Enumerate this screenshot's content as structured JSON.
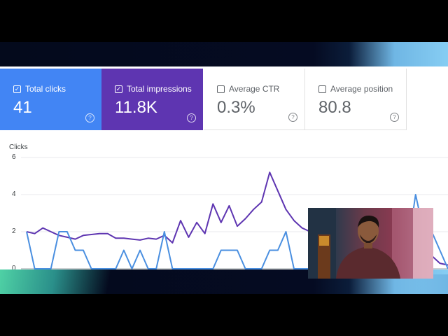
{
  "metrics": [
    {
      "label": "Total clicks",
      "value": "41",
      "active": true,
      "color": "#4285f4"
    },
    {
      "label": "Total impressions",
      "value": "11.8K",
      "active": true,
      "color": "#5e35b1"
    },
    {
      "label": "Average CTR",
      "value": "0.3%",
      "active": false
    },
    {
      "label": "Average position",
      "value": "80.8",
      "active": false
    }
  ],
  "chart": {
    "axis_title": "Clicks",
    "y_ticks": [
      "6",
      "4",
      "2",
      "0"
    ]
  },
  "chart_data": {
    "type": "line",
    "ylabel": "Clicks",
    "ylim": [
      0,
      6
    ],
    "grid": true,
    "series": [
      {
        "name": "Total clicks",
        "color": "#4a8fe0",
        "values": [
          2,
          0,
          0,
          0,
          2,
          2,
          1,
          1,
          0,
          0,
          0,
          0,
          1,
          0,
          1,
          0,
          0,
          2,
          0,
          0,
          0,
          0,
          0,
          0,
          1,
          1,
          1,
          0,
          0,
          0,
          1,
          1,
          2,
          0,
          0,
          0,
          0,
          0,
          0,
          0,
          0,
          0,
          0,
          0,
          0,
          0,
          0,
          1,
          4,
          2,
          2,
          1,
          0
        ]
      },
      {
        "name": "Total impressions",
        "color": "#5e35b1",
        "values": [
          2.0,
          1.9,
          2.2,
          2.0,
          1.8,
          1.7,
          1.6,
          1.8,
          1.85,
          1.9,
          1.9,
          1.65,
          1.65,
          1.6,
          1.55,
          1.65,
          1.6,
          1.8,
          1.4,
          2.6,
          1.7,
          2.5,
          1.9,
          3.5,
          2.5,
          3.4,
          2.3,
          2.7,
          3.2,
          3.6,
          5.2,
          4.2,
          3.2,
          2.6,
          2.2,
          2.0,
          1.9,
          1.8,
          1.7,
          1.6,
          1.5,
          1.4,
          1.3,
          1.2,
          1.1,
          1.0,
          0.9,
          0.8,
          0.9,
          1.0,
          0.7,
          0.3,
          0.2
        ]
      }
    ]
  },
  "overlay": {
    "webcam": "webcam-video"
  }
}
